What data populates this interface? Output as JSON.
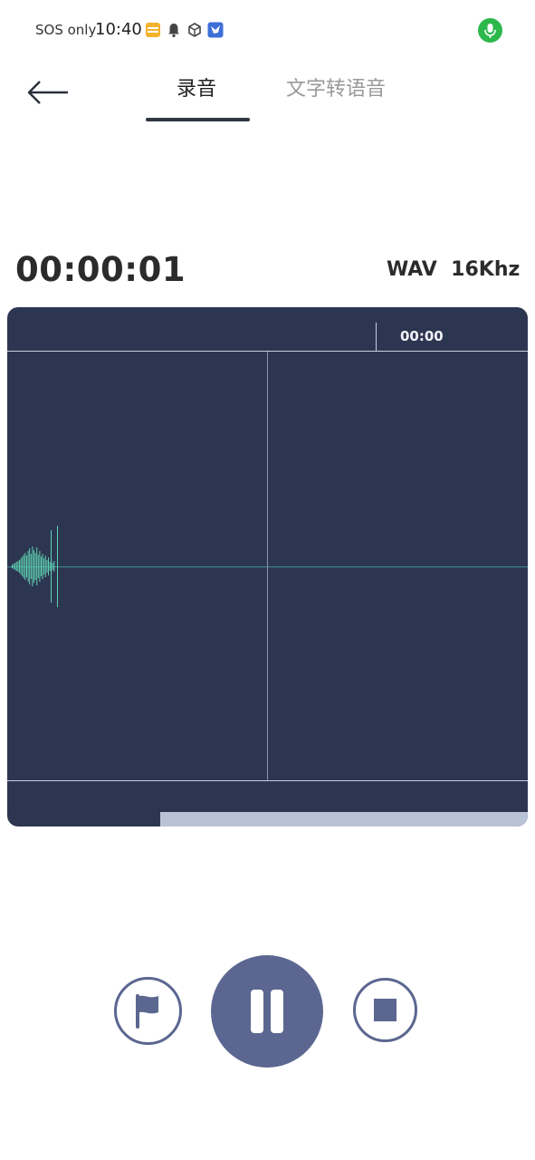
{
  "status_bar": {
    "carrier": "SOS only",
    "time": "10:40",
    "icons": [
      "notes-app-icon",
      "bell-icon",
      "package-icon",
      "bird-app-icon",
      "mic-active-icon"
    ]
  },
  "header": {
    "back_icon": "arrow-left-icon",
    "tabs": [
      {
        "label": "录音",
        "active": true
      },
      {
        "label": "文字转语音",
        "active": false
      }
    ]
  },
  "recording": {
    "elapsed": "00:00:01",
    "format": "WAV  16Khz"
  },
  "waveform": {
    "ruler_label": "00:00",
    "progress": 0.29
  },
  "controls": {
    "flag_icon": "flag-icon",
    "pause_icon": "pause-icon",
    "stop_icon": "stop-icon"
  },
  "colors": {
    "panel_bg": "#2d3651",
    "wave": "#5fd0b0",
    "accent": "#5b6790",
    "mic_badge": "#2db84c"
  }
}
